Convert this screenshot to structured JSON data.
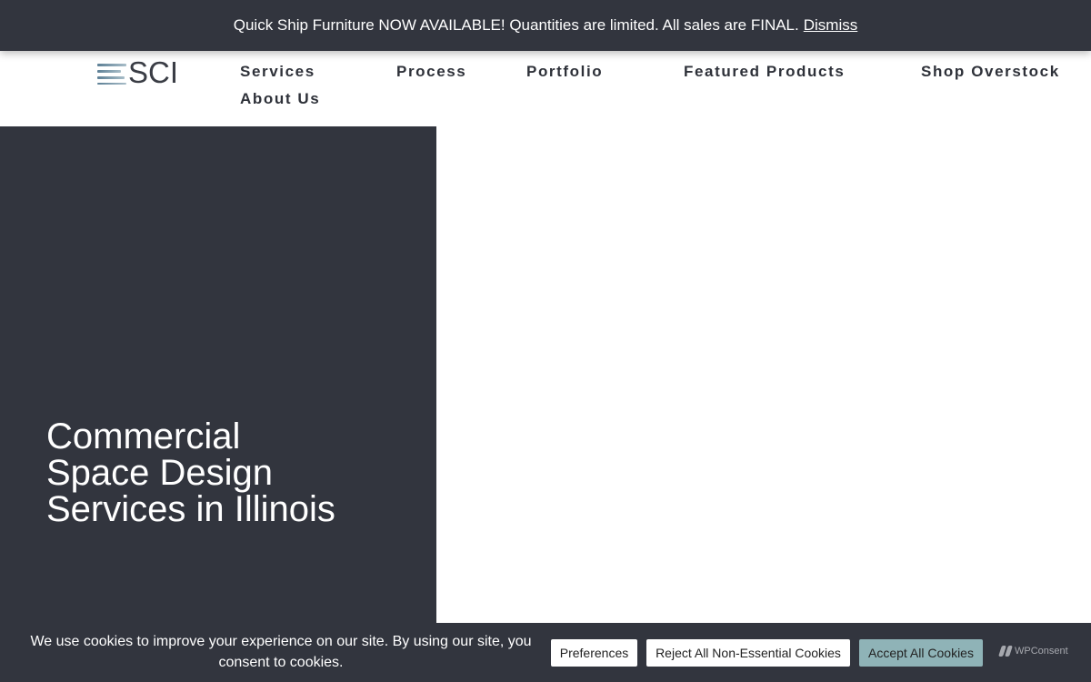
{
  "promo": {
    "message": "Quick Ship Furniture NOW AVAILABLE! Quantities are limited. All sales are FINAL.",
    "dismiss_label": "Dismiss"
  },
  "header": {
    "logo_text": "SCI",
    "nav": [
      {
        "label": "Services"
      },
      {
        "label": "Process"
      },
      {
        "label": "Portfolio"
      },
      {
        "label": "Featured Products"
      },
      {
        "label": "Shop Overstock"
      },
      {
        "label": "About Us"
      }
    ]
  },
  "hero": {
    "title_lines": [
      "Commercial",
      "Space Design",
      "Services in Illinois"
    ]
  },
  "cookie": {
    "message": "We use cookies to improve your experience on our site. By using our site, you consent to cookies.",
    "preferences_label": "Preferences",
    "reject_label": "Reject All Non-Essential Cookies",
    "accept_label": "Accept All Cookies",
    "brand_label": "WPConsent"
  },
  "colors": {
    "dark": "#32353e",
    "accent_button": "#8fb3b7",
    "logo_accent": "#5c7f95"
  }
}
